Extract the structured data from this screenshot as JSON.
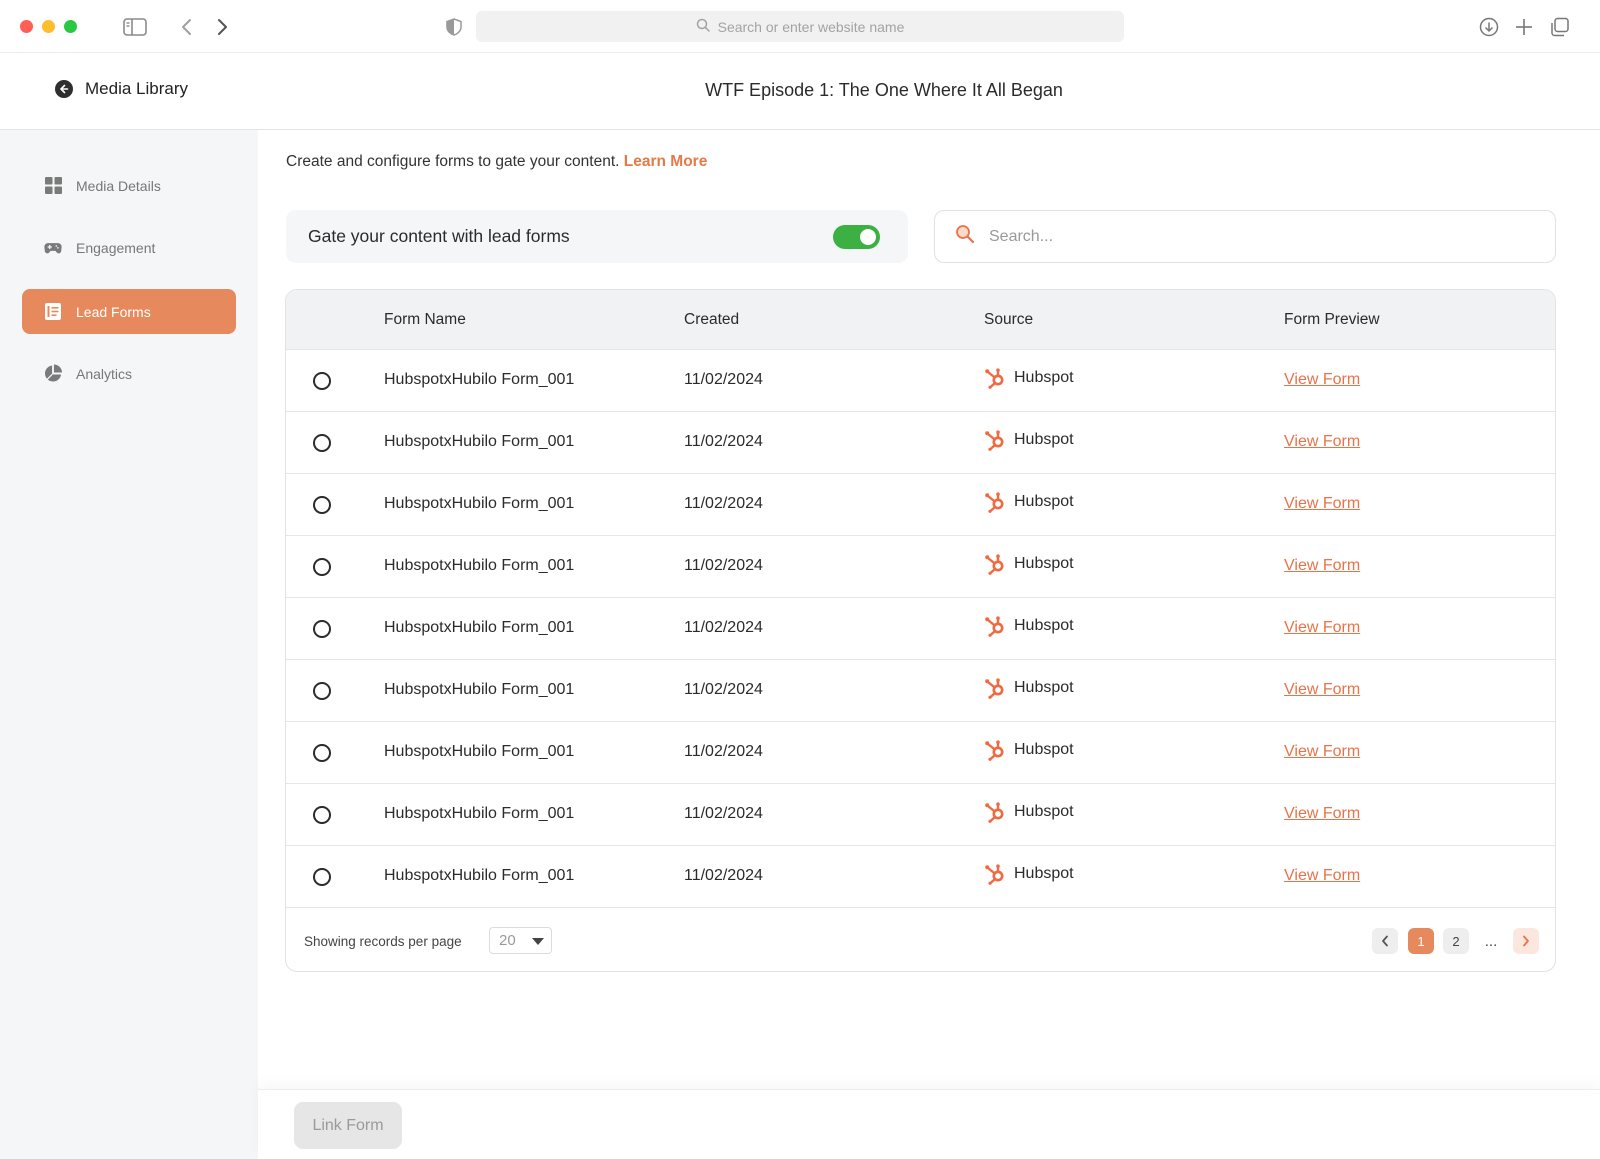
{
  "browser": {
    "url_placeholder": "Search or enter website name"
  },
  "header": {
    "back_label": "Media Library",
    "title": "WTF Episode 1: The One Where It All Began"
  },
  "sidebar": {
    "items": [
      {
        "label": "Media Details",
        "icon": "grid-icon",
        "active": false
      },
      {
        "label": "Engagement",
        "icon": "gamepad-icon",
        "active": false
      },
      {
        "label": "Lead Forms",
        "icon": "form-icon",
        "active": true
      },
      {
        "label": "Analytics",
        "icon": "pie-chart-icon",
        "active": false
      }
    ]
  },
  "main": {
    "intro_text": "Create and configure forms to gate your content.",
    "learn_more": "Learn More",
    "gate_label": "Gate your content with lead forms",
    "gate_enabled": true,
    "search_placeholder": "Search..."
  },
  "table": {
    "columns": [
      "Form Name",
      "Created",
      "Source",
      "Form Preview"
    ],
    "rows": [
      {
        "name": "HubspotxHubilo Form_001",
        "created": "11/02/2024",
        "source": "Hubspot",
        "preview": "View Form"
      },
      {
        "name": "HubspotxHubilo Form_001",
        "created": "11/02/2024",
        "source": "Hubspot",
        "preview": "View Form"
      },
      {
        "name": "HubspotxHubilo Form_001",
        "created": "11/02/2024",
        "source": "Hubspot",
        "preview": "View Form"
      },
      {
        "name": "HubspotxHubilo Form_001",
        "created": "11/02/2024",
        "source": "Hubspot",
        "preview": "View Form"
      },
      {
        "name": "HubspotxHubilo Form_001",
        "created": "11/02/2024",
        "source": "Hubspot",
        "preview": "View Form"
      },
      {
        "name": "HubspotxHubilo Form_001",
        "created": "11/02/2024",
        "source": "Hubspot",
        "preview": "View Form"
      },
      {
        "name": "HubspotxHubilo Form_001",
        "created": "11/02/2024",
        "source": "Hubspot",
        "preview": "View Form"
      },
      {
        "name": "HubspotxHubilo Form_001",
        "created": "11/02/2024",
        "source": "Hubspot",
        "preview": "View Form"
      },
      {
        "name": "HubspotxHubilo Form_001",
        "created": "11/02/2024",
        "source": "Hubspot",
        "preview": "View Form"
      }
    ],
    "per_page_label": "Showing records per page",
    "per_page_value": "20",
    "pages": [
      "1",
      "2"
    ],
    "ellipsis": "...",
    "current_page": "1"
  },
  "footer": {
    "link_form_label": "Link Form"
  },
  "colors": {
    "accent": "#e6895c",
    "link": "#e8734a",
    "toggle_on": "#3cb043",
    "hubspot": "#f1693f"
  }
}
